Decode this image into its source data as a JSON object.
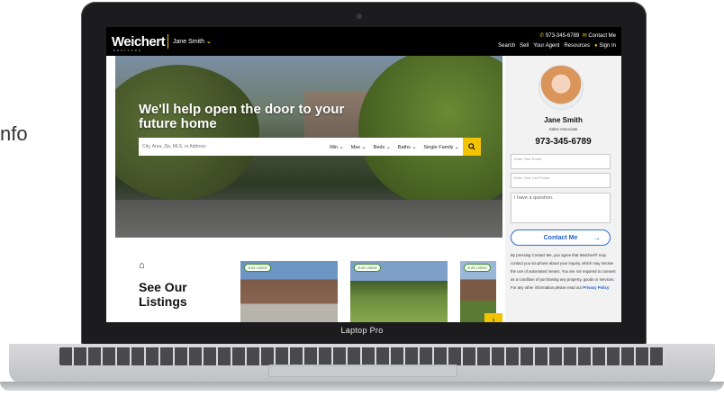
{
  "background_text": "nfo",
  "device_label": "Laptop Pro",
  "site": {
    "logo": "Weichert",
    "logo_sub": "REALTORS",
    "agent_selector": "Jane Smith",
    "top_phone": "973-345-6789",
    "top_contact": "Contact Me",
    "nav": [
      "Search",
      "Sell",
      "Your Agent",
      "Resources",
      "Sign In"
    ]
  },
  "hero": {
    "title": "We'll help open the door to your future home",
    "search_placeholder": "City, Area, Zip, MLS, or Address",
    "filters": [
      "Min",
      "Max",
      "Beds",
      "Baths",
      "Single Family"
    ]
  },
  "listings": {
    "title": "See Our Listings",
    "badges": [
      "Just Listed",
      "Just Listed",
      "Just Listed"
    ]
  },
  "agent_panel": {
    "name": "Jane Smith",
    "title": "Sales Associate",
    "phone": "973-345-6789",
    "email_placeholder": "Enter Your Email",
    "phone_placeholder": "Enter Your Cell Phone",
    "message": "I have a question.",
    "button": "Contact Me",
    "disclaimer": "By pressing Contact Me, you agree that Weichert® may contact you via phone about your inquiry, which may involve the use of automated means. You are not required to consent as a condition of purchasing any property, goods or services. For any other information please read our",
    "privacy_link": "Privacy Policy"
  },
  "colors": {
    "accent": "#f2c400",
    "link": "#1d5fc9",
    "topbar": "#000000"
  }
}
